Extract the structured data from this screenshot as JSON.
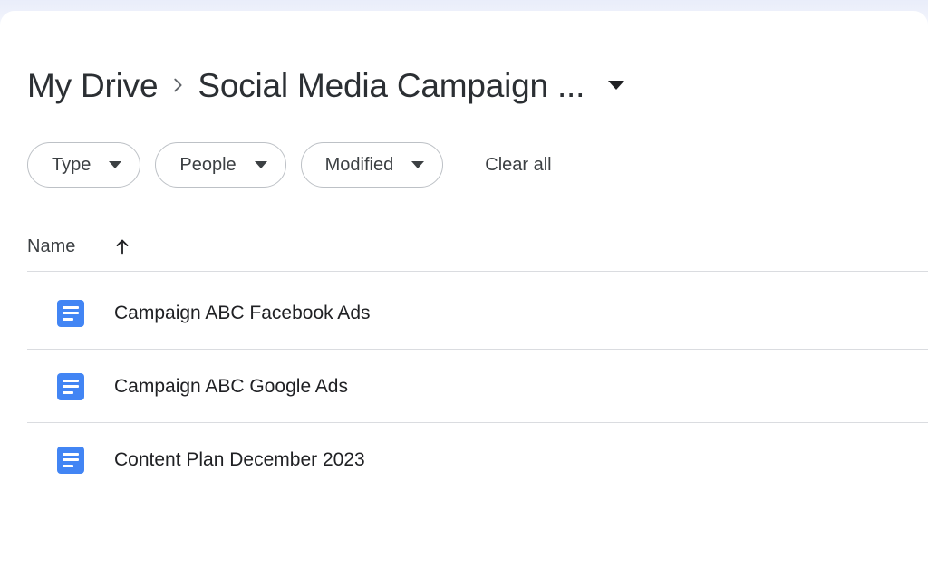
{
  "theme": {
    "accent_blue": "#4285F4",
    "text_primary": "#202124",
    "text_secondary": "#3C4043",
    "divider": "#DADCE0",
    "band": "#ECEFF9",
    "panel_bg": "#FFFFFF"
  },
  "breadcrumb": {
    "root_label": "My Drive",
    "separator_icon": "chevron-right-icon",
    "current_label": "Social Media Campaign ...",
    "caret_icon": "caret-down-icon"
  },
  "filters": {
    "chips": [
      {
        "label": "Type",
        "caret_icon": "chevron-down-icon"
      },
      {
        "label": "People",
        "caret_icon": "chevron-down-icon"
      },
      {
        "label": "Modified",
        "caret_icon": "chevron-down-icon"
      }
    ],
    "clear_all_label": "Clear all"
  },
  "list": {
    "columns": [
      {
        "label": "Name",
        "sort_icon": "arrow-up-icon",
        "sort_direction": "ascending"
      }
    ],
    "rows": [
      {
        "icon": "google-docs-icon",
        "name": "Campaign ABC Facebook Ads"
      },
      {
        "icon": "google-docs-icon",
        "name": "Campaign ABC Google Ads"
      },
      {
        "icon": "google-docs-icon",
        "name": "Content Plan December 2023"
      }
    ]
  }
}
